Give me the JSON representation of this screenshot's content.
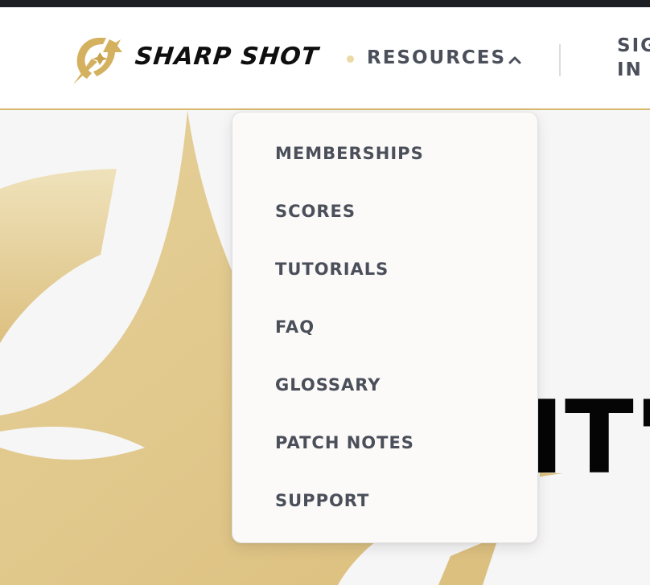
{
  "header": {
    "brand": "SHARP SHOT",
    "nav": {
      "resources_label": "RESOURCES",
      "signin_line1": "SIG",
      "signin_line2": "IN"
    }
  },
  "dropdown": {
    "items": [
      {
        "label": "MEMBERSHIPS"
      },
      {
        "label": "SCORES"
      },
      {
        "label": "TUTORIALS"
      },
      {
        "label": "FAQ"
      },
      {
        "label": "GLOSSARY"
      },
      {
        "label": "PATCH NOTES"
      },
      {
        "label": "SUPPORT"
      }
    ]
  },
  "hero": {
    "heading_fragment": "IT'"
  },
  "colors": {
    "accent_gold": "#d8b86a",
    "text_dark": "#4a4f5a",
    "topbar": "#1d1f24"
  },
  "icons": {
    "logo": "star-leaf-logo-icon",
    "resources_toggle": "chevron-up-icon"
  }
}
